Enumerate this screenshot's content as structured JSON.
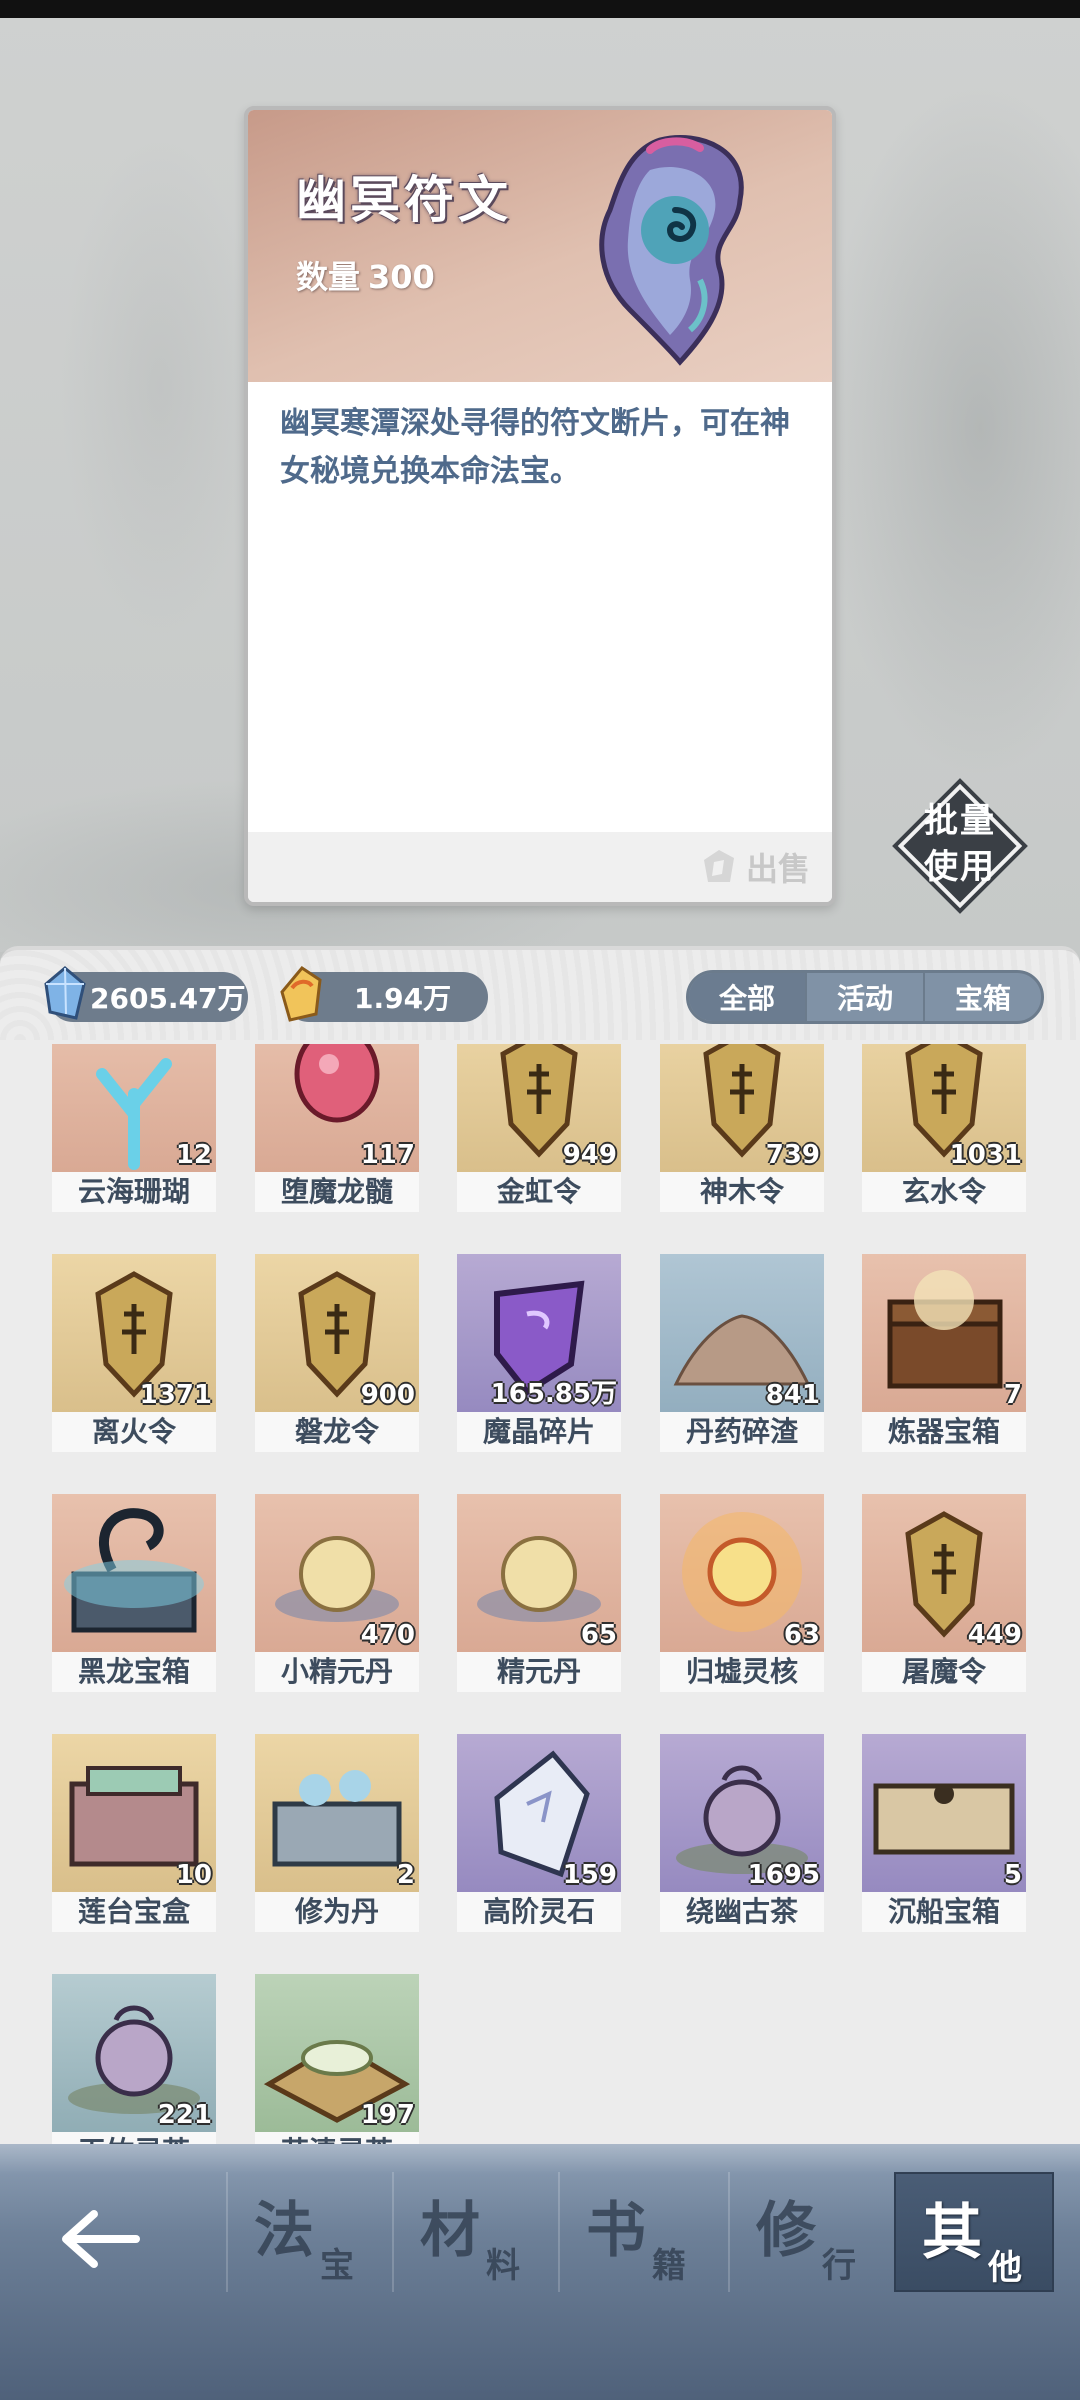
{
  "detail": {
    "title": "幽冥符文",
    "quantity_label": "数量",
    "quantity_value": "300",
    "description": "幽冥寒潭深处寻得的符文断片，可在神女秘境兑换本命法宝。",
    "sell_label": "出售"
  },
  "batch_use": {
    "line1": "批量",
    "line2": "使用"
  },
  "currencies": {
    "crystal": "2605.47万",
    "gold": "1.94万"
  },
  "filter_tabs": [
    "全部",
    "活动",
    "宝箱"
  ],
  "items": [
    {
      "name": "云海珊瑚",
      "count": "12",
      "bg": "peach",
      "icon": "coral-icon"
    },
    {
      "name": "堕魔龙髓",
      "count": "117",
      "bg": "peach",
      "icon": "dragon-marrow-icon"
    },
    {
      "name": "金虹令",
      "count": "949",
      "bg": "tan",
      "icon": "token-icon"
    },
    {
      "name": "神木令",
      "count": "739",
      "bg": "tan",
      "icon": "token-icon"
    },
    {
      "name": "玄水令",
      "count": "1031",
      "bg": "tan",
      "icon": "token-icon"
    },
    {
      "name": "离火令",
      "count": "1371",
      "bg": "tan",
      "icon": "token-icon"
    },
    {
      "name": "磐龙令",
      "count": "900",
      "bg": "tan",
      "icon": "token-icon"
    },
    {
      "name": "魔晶碎片",
      "count": "165.85万",
      "bg": "purple",
      "icon": "crystal-shard-icon"
    },
    {
      "name": "丹药碎渣",
      "count": "841",
      "bg": "blue",
      "icon": "pill-dust-icon"
    },
    {
      "name": "炼器宝箱",
      "count": "7",
      "bg": "peach",
      "icon": "chest-icon"
    },
    {
      "name": "黑龙宝箱",
      "count": "",
      "bg": "peach",
      "icon": "dragon-chest-icon"
    },
    {
      "name": "小精元丹",
      "count": "470",
      "bg": "peach",
      "icon": "pill-icon"
    },
    {
      "name": "精元丹",
      "count": "65",
      "bg": "peach",
      "icon": "pill-icon"
    },
    {
      "name": "归墟灵核",
      "count": "63",
      "bg": "peach",
      "icon": "spirit-core-icon"
    },
    {
      "name": "屠魔令",
      "count": "449",
      "bg": "peach",
      "icon": "token-icon"
    },
    {
      "name": "莲台宝盒",
      "count": "10",
      "bg": "tan",
      "icon": "box-icon"
    },
    {
      "name": "修为丹",
      "count": "2",
      "bg": "tan",
      "icon": "pill-box-icon"
    },
    {
      "name": "高阶灵石",
      "count": "159",
      "bg": "purple",
      "icon": "spirit-stone-icon"
    },
    {
      "name": "绕幽古茶",
      "count": "1695",
      "bg": "purple",
      "icon": "teapot-icon"
    },
    {
      "name": "沉船宝箱",
      "count": "5",
      "bg": "purple",
      "icon": "wood-chest-icon"
    },
    {
      "name": "玉竹灵茶",
      "count": "221",
      "bg": "teal",
      "icon": "teapot-icon"
    },
    {
      "name": "花清灵茶",
      "count": "197",
      "bg": "green",
      "icon": "tea-bowl-icon"
    }
  ],
  "bottom_nav": [
    {
      "big": "法",
      "small": "宝"
    },
    {
      "big": "材",
      "small": "料"
    },
    {
      "big": "书",
      "small": "籍"
    },
    {
      "big": "修",
      "small": "行"
    },
    {
      "big": "其",
      "small": "他"
    }
  ]
}
